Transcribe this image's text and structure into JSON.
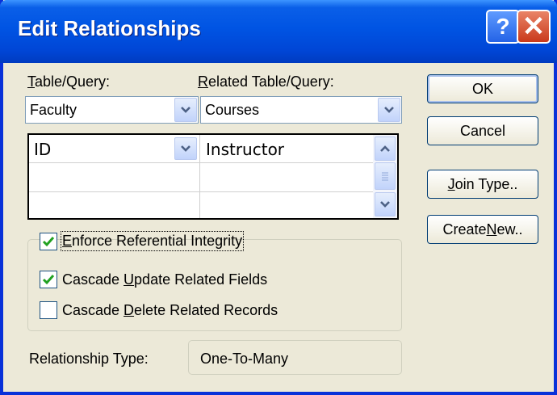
{
  "window": {
    "title": "Edit Relationships"
  },
  "titlebar_buttons": {
    "help": "?",
    "close": "✕"
  },
  "labels": {
    "table_query": {
      "pre": "",
      "acc": "T",
      "post": "able/Query:"
    },
    "related_table_query": {
      "pre": "",
      "acc": "R",
      "post": "elated Table/Query:"
    }
  },
  "combos": {
    "table_query_value": "Faculty",
    "related_table_value": "Courses"
  },
  "field_grid": {
    "rows": [
      {
        "left": "ID",
        "right": "Instructor"
      },
      {
        "left": "",
        "right": ""
      },
      {
        "left": "",
        "right": ""
      }
    ]
  },
  "options": {
    "enforce": {
      "pre": "",
      "acc": "E",
      "post": "nforce Referential Integrity",
      "checked": true
    },
    "cascade_update": {
      "pre": "Cascade ",
      "acc": "U",
      "post": "pdate Related Fields",
      "checked": true
    },
    "cascade_delete": {
      "pre": "Cascade ",
      "acc": "D",
      "post": "elete Related Records",
      "checked": false
    }
  },
  "relationship": {
    "label": "Relationship Type:",
    "value": "One-To-Many"
  },
  "buttons": {
    "ok": {
      "pre": "OK",
      "acc": "",
      "post": ""
    },
    "cancel": {
      "pre": "Cancel",
      "acc": "",
      "post": ""
    },
    "join": {
      "pre": "",
      "acc": "J",
      "post": "oin Type.."
    },
    "create": {
      "pre": "Create ",
      "acc": "N",
      "post": "ew.."
    }
  }
}
